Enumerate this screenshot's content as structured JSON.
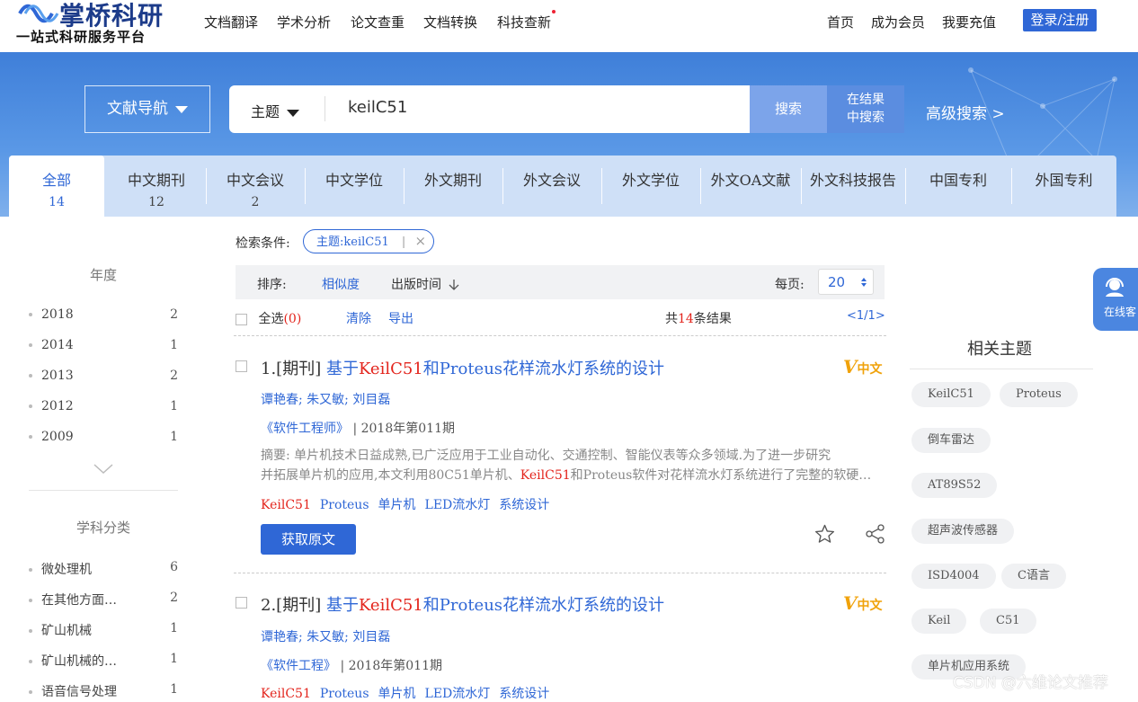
{
  "header": {
    "logo_title": "掌桥科研",
    "logo_subtitle": "一站式科研服务平台",
    "nav_left": [
      "文档翻译",
      "学术分析",
      "论文查重",
      "文档转换",
      "科技查新"
    ],
    "nav_right": [
      "首页",
      "成为会员",
      "我要充值"
    ],
    "login_label": "登录/注册"
  },
  "search": {
    "nav_select": "文献导航",
    "scope": "主题",
    "query": "keilC51",
    "search_button": "搜索",
    "within_button_line1": "在结果",
    "within_button_line2": "中搜索",
    "advanced": "高级搜索 >"
  },
  "tabs": [
    {
      "label": "全部",
      "count": "14"
    },
    {
      "label": "中文期刊",
      "count": "12"
    },
    {
      "label": "中文会议",
      "count": "2"
    },
    {
      "label": "中文学位",
      "count": ""
    },
    {
      "label": "外文期刊",
      "count": ""
    },
    {
      "label": "外文会议",
      "count": ""
    },
    {
      "label": "外文学位",
      "count": ""
    },
    {
      "label": "外文OA文献",
      "count": ""
    },
    {
      "label": "外文科技报告",
      "count": ""
    },
    {
      "label": "中国专利",
      "count": ""
    },
    {
      "label": "外国专利",
      "count": ""
    }
  ],
  "sidebar": {
    "year_heading": "年度",
    "years": [
      {
        "label": "2018",
        "count": "2"
      },
      {
        "label": "2014",
        "count": "1"
      },
      {
        "label": "2013",
        "count": "2"
      },
      {
        "label": "2012",
        "count": "1"
      },
      {
        "label": "2009",
        "count": "1"
      }
    ],
    "subject_heading": "学科分类",
    "subjects": [
      {
        "label": "微处理机",
        "count": "6"
      },
      {
        "label": "在其他方面…",
        "count": "2"
      },
      {
        "label": "矿山机械",
        "count": "1"
      },
      {
        "label": "矿山机械的…",
        "count": "1"
      },
      {
        "label": "语音信号处理",
        "count": "1"
      }
    ]
  },
  "filters": {
    "label": "检索条件:",
    "chip": "主题:keilC51",
    "chip_sep": "|",
    "chip_close": "×"
  },
  "sortbar": {
    "label": "排序:",
    "relevance": "相似度",
    "pubdate": "出版时间",
    "per_page_label": "每页:",
    "per_page_value": "20"
  },
  "results_bar": {
    "select_all": "全选",
    "selected_count": "(0)",
    "clear": "清除",
    "export": "导出",
    "total_prefix": "共",
    "total": "14",
    "total_suffix": "条结果",
    "pager": "<1/1>"
  },
  "results": [
    {
      "index": "1.[期刊]",
      "title_a": "基于",
      "title_hl": "KeilC51",
      "title_b": "和Proteus花样流水灯系统的设计",
      "authors": "谭艳春; 朱又敏; 刘目磊",
      "journal": "《软件工程师》",
      "issue": "| 2018年第011期",
      "abstract_1": "摘要: 单片机技术日益成熟,已广泛应用于工业自动化、交通控制、智能仪表等众多领域.为了进一步研究",
      "abstract_2a": "并拓展单片机的应用,本文利用80C51单片机、",
      "abstract_2hl": "KeilC51",
      "abstract_2b": "和Proteus软件对花样流水灯系统进行了完整的软硬…",
      "keywords": [
        "KeilC51",
        "Proteus",
        "单片机",
        "LED流水灯",
        "系统设计"
      ],
      "badge": "中文",
      "get_label": "获取原文"
    },
    {
      "index": "2.[期刊]",
      "title_a": "基于",
      "title_hl": "KeilC51",
      "title_b": "和Proteus花样流水灯系统的设计",
      "authors": "谭艳春; 朱又敏; 刘目磊",
      "journal": "《软件工程》",
      "issue": "| 2018年第011期",
      "keywords": [
        "KeilC51",
        "Proteus",
        "单片机",
        "LED流水灯",
        "系统设计"
      ],
      "badge": "中文"
    }
  ],
  "related": {
    "heading": "相关主题",
    "tags": [
      "KeilC51",
      "Proteus",
      "倒车雷达",
      "AT89S52",
      "超声波传感器",
      "ISD4004",
      "C语言",
      "Keil",
      "C51",
      "单片机应用系统"
    ]
  },
  "float_service": "在线客",
  "watermark": "CSDN @六维论文推荐"
}
